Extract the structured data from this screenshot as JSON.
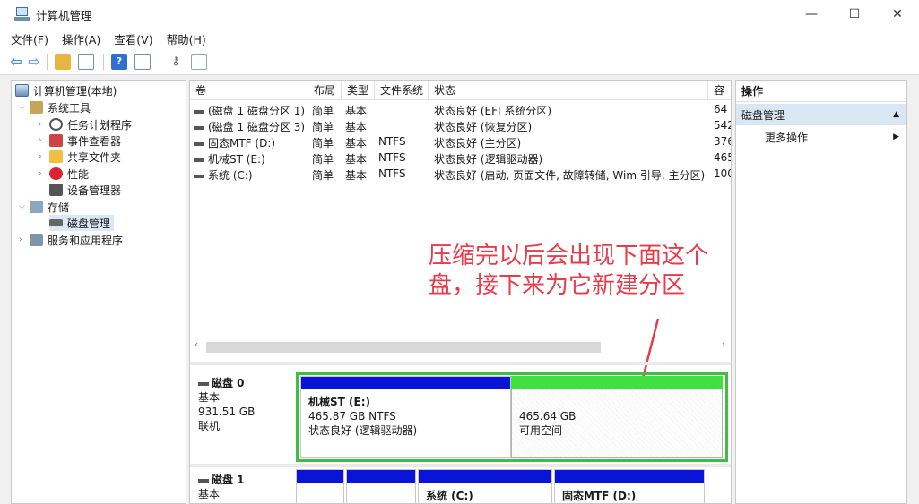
{
  "window": {
    "title": "计算机管理",
    "minimize": "—",
    "maximize": "☐",
    "close": "✕"
  },
  "menu": [
    "文件(F)",
    "操作(A)",
    "查看(V)",
    "帮助(H)"
  ],
  "toolbar": {
    "back": "⇦",
    "forward": "⇨",
    "help": "?"
  },
  "tree": [
    {
      "label": "计算机管理(本地)",
      "icon": "computer-icon"
    },
    {
      "label": "系统工具",
      "icon": "tools-icon"
    },
    {
      "label": "任务计划程序",
      "icon": "clock-icon"
    },
    {
      "label": "事件查看器",
      "icon": "event-viewer-icon"
    },
    {
      "label": "共享文件夹",
      "icon": "shared-folder-icon"
    },
    {
      "label": "性能",
      "icon": "performance-icon"
    },
    {
      "label": "设备管理器",
      "icon": "device-manager-icon"
    },
    {
      "label": "存储",
      "icon": "storage-icon"
    },
    {
      "label": "磁盘管理",
      "icon": "disk-icon"
    },
    {
      "label": "服务和应用程序",
      "icon": "services-icon"
    }
  ],
  "columns": [
    "卷",
    "布局",
    "类型",
    "文件系统",
    "状态",
    "容"
  ],
  "volumes": [
    {
      "name": "(磁盘 1 磁盘分区 1)",
      "layout": "简单",
      "type": "基本",
      "fs": "",
      "status": "状态良好 (EFI 系统分区)",
      "cap": "64"
    },
    {
      "name": "(磁盘 1 磁盘分区 3)",
      "layout": "简单",
      "type": "基本",
      "fs": "",
      "status": "状态良好 (恢复分区)",
      "cap": "542"
    },
    {
      "name": "固态MTF (D:)",
      "layout": "简单",
      "type": "基本",
      "fs": "NTFS",
      "status": "状态良好 (主分区)",
      "cap": "376"
    },
    {
      "name": "机械ST (E:)",
      "layout": "简单",
      "type": "基本",
      "fs": "NTFS",
      "status": "状态良好 (逻辑驱动器)",
      "cap": "465"
    },
    {
      "name": "系统 (C:)",
      "layout": "简单",
      "type": "基本",
      "fs": "NTFS",
      "status": "状态良好 (启动, 页面文件, 故障转储, Wim 引导, 主分区)",
      "cap": "100"
    }
  ],
  "annotation": {
    "line1": "压缩完以后会出现下面这个",
    "line2": "盘，接下来为它新建分区"
  },
  "disk0": {
    "name": "磁盘 0",
    "type": "基本",
    "size": "931.51 GB",
    "state": "联机",
    "part1": {
      "label": "机械ST  (E:)",
      "size": "465.87 GB NTFS",
      "status": "状态良好 (逻辑驱动器)"
    },
    "free": {
      "size": "465.64 GB",
      "label": "可用空间"
    }
  },
  "disk1": {
    "name": "磁盘 1",
    "type": "基本",
    "partC": {
      "label": "系统  (C:)"
    },
    "partD": {
      "label": "固态MTF  (D:)"
    }
  },
  "actions": {
    "header": "操作",
    "selected": "磁盘管理",
    "more": "更多操作"
  },
  "colors": {
    "primary_partition": "#0a14d8",
    "free_space": "#3fe03f",
    "annotation": "#e83c4a"
  }
}
